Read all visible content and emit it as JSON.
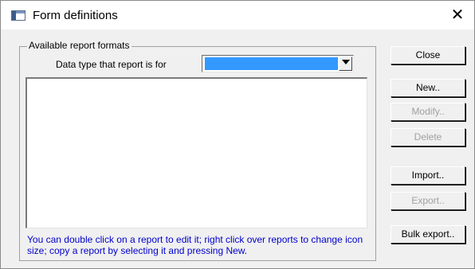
{
  "window": {
    "title": "Form definitions",
    "close_glyph": "✕",
    "app_icon": "form-window-icon"
  },
  "group": {
    "label": "Available report formats",
    "data_type_label": "Data type that report is for",
    "data_type_value": "",
    "list_items": [],
    "hint": "You can double click on a report to edit it; right click over reports to change icon size; copy a report by selecting it and pressing New."
  },
  "buttons": {
    "close": "Close",
    "new": "New..",
    "modify": "Modify..",
    "delete": "Delete",
    "import": "Import..",
    "export": "Export..",
    "bulk_export": "Bulk export.."
  },
  "colors": {
    "selection": "#3399ff",
    "hint_text": "#0000cc",
    "disabled_text": "#a0a0a0"
  }
}
